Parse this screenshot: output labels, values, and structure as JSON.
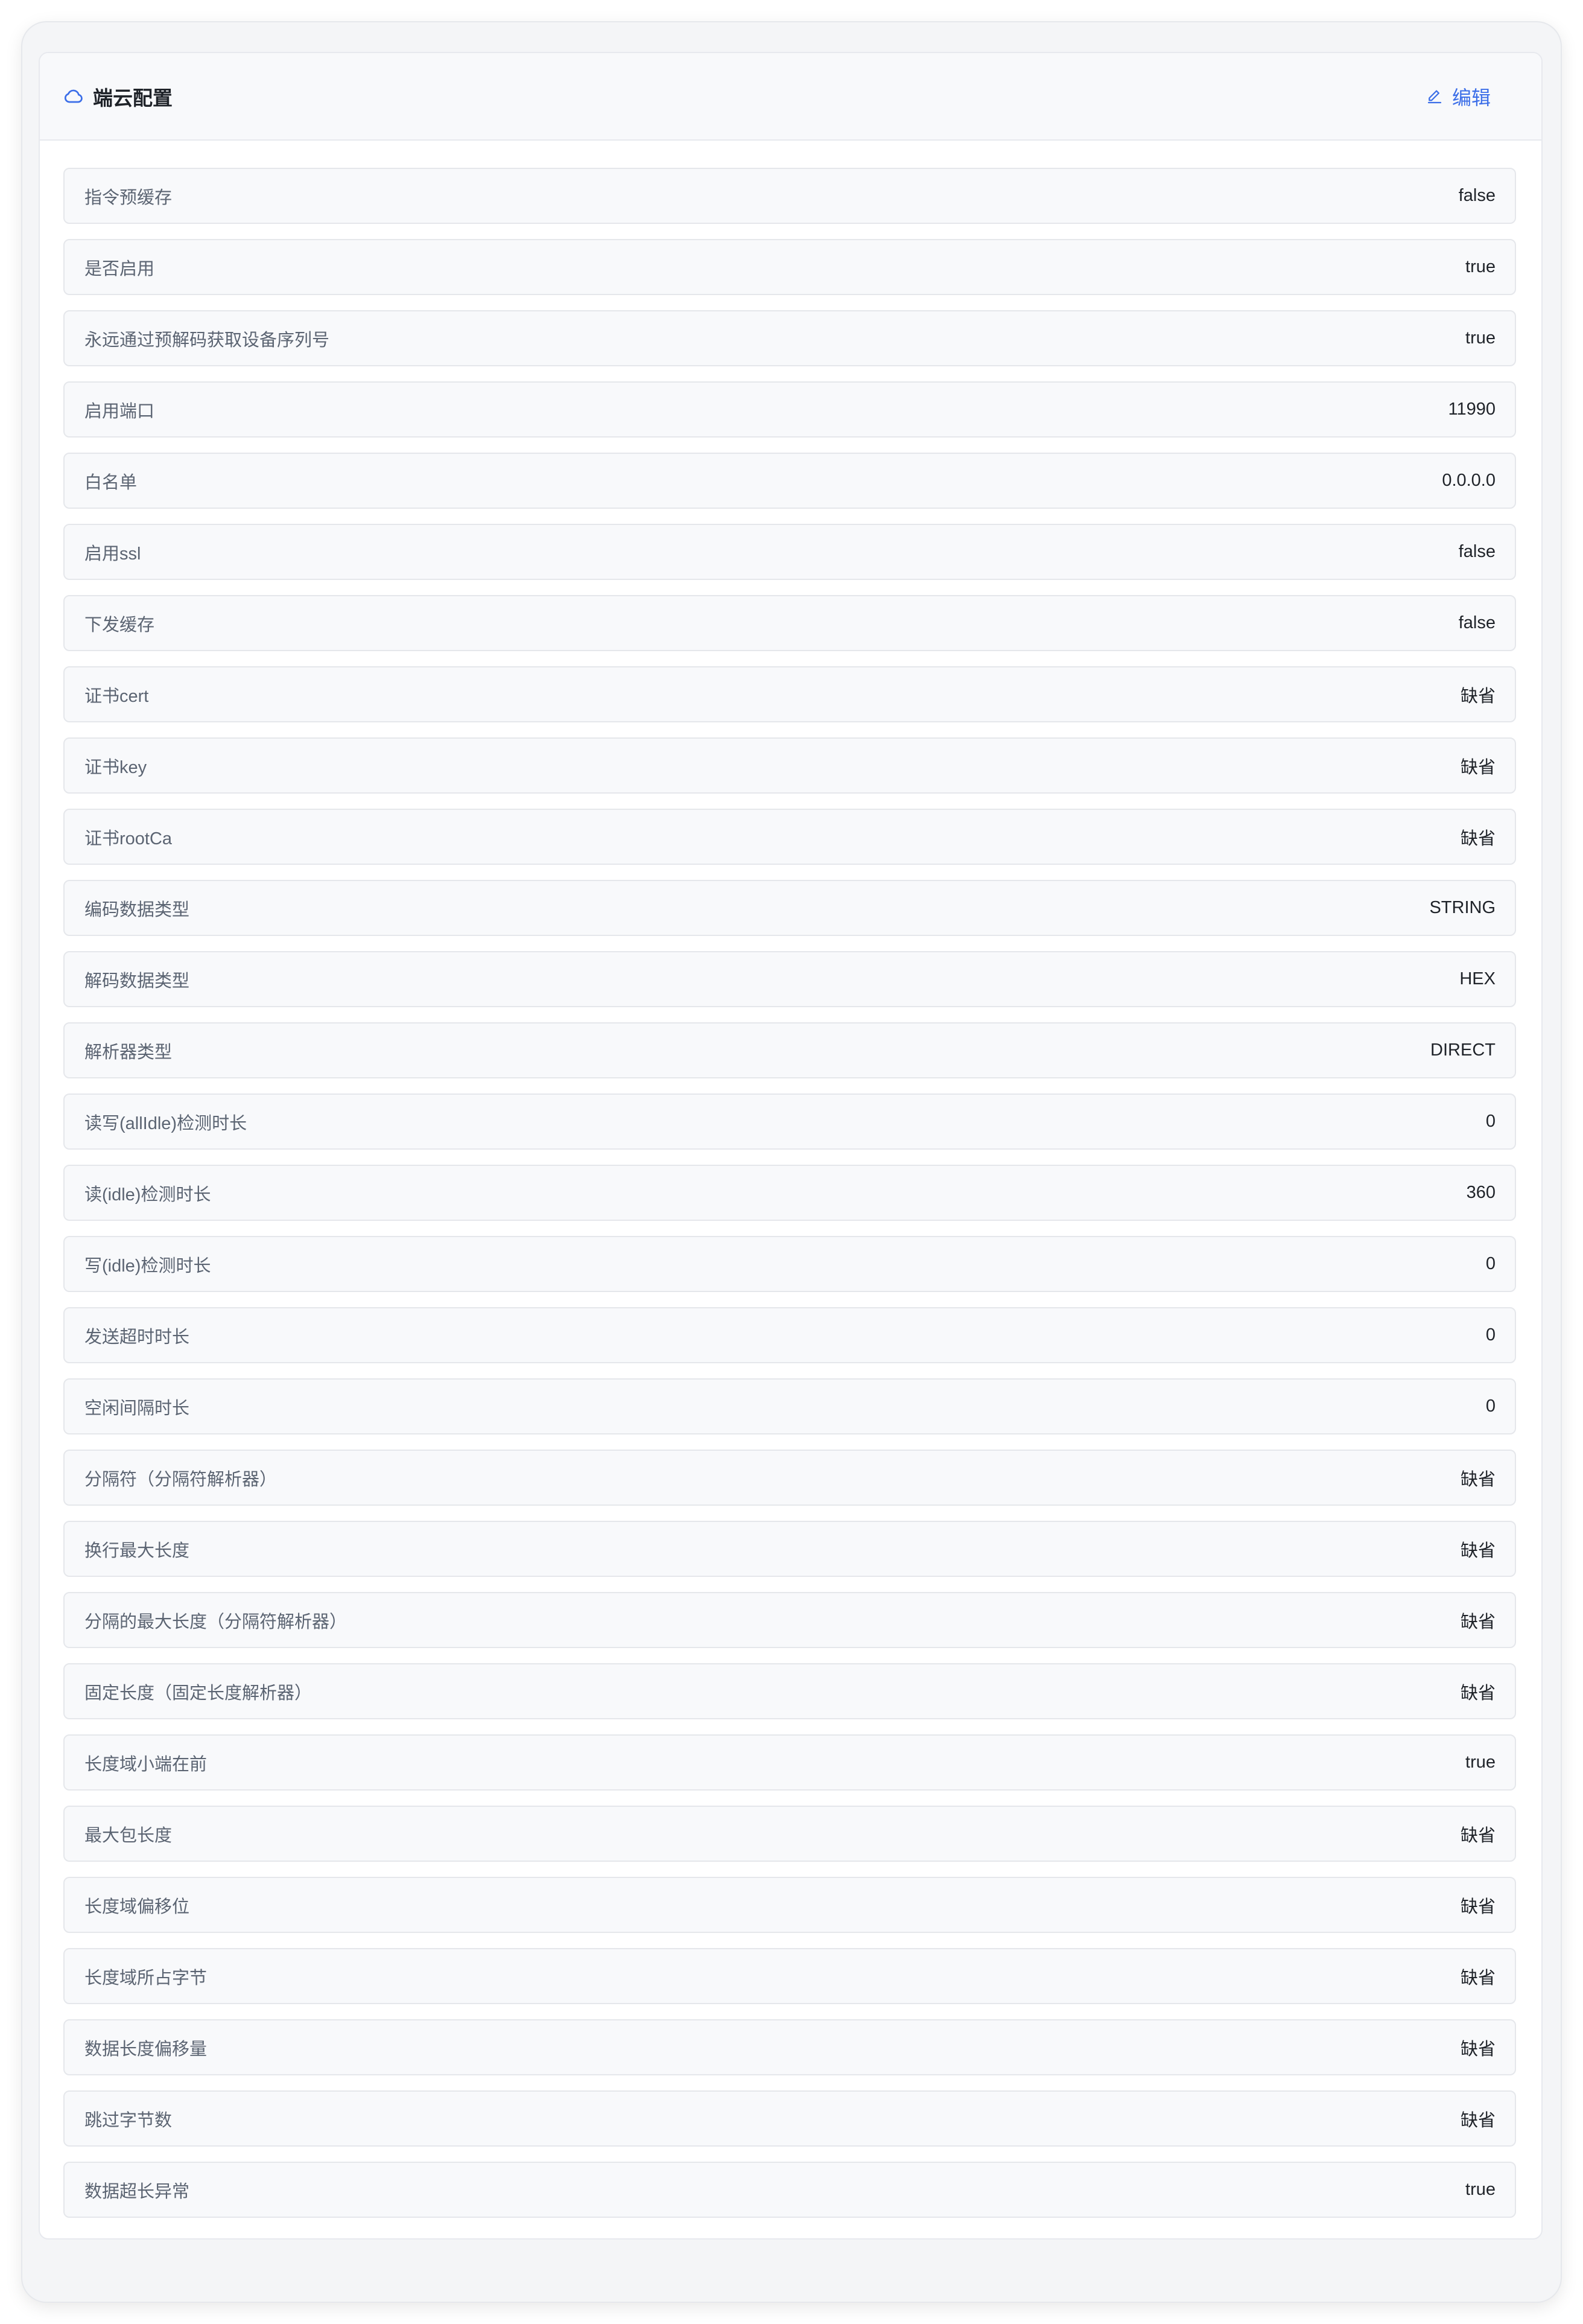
{
  "header": {
    "title": "端云配置",
    "icon": "cloud-icon",
    "edit_label": "编辑",
    "accent_color": "#3b6ee8"
  },
  "rows": [
    {
      "label": "指令预缓存",
      "value": "false"
    },
    {
      "label": "是否启用",
      "value": "true"
    },
    {
      "label": "永远通过预解码获取设备序列号",
      "value": "true"
    },
    {
      "label": "启用端口",
      "value": "11990"
    },
    {
      "label": "白名单",
      "value": "0.0.0.0"
    },
    {
      "label": "启用ssl",
      "value": "false"
    },
    {
      "label": "下发缓存",
      "value": "false"
    },
    {
      "label": "证书cert",
      "value": "缺省"
    },
    {
      "label": "证书key",
      "value": "缺省"
    },
    {
      "label": "证书rootCa",
      "value": "缺省"
    },
    {
      "label": "编码数据类型",
      "value": "STRING"
    },
    {
      "label": "解码数据类型",
      "value": "HEX"
    },
    {
      "label": "解析器类型",
      "value": "DIRECT"
    },
    {
      "label": "读写(allIdle)检测时长",
      "value": "0"
    },
    {
      "label": "读(idle)检测时长",
      "value": "360"
    },
    {
      "label": "写(idle)检测时长",
      "value": "0"
    },
    {
      "label": "发送超时时长",
      "value": "0"
    },
    {
      "label": "空闲间隔时长",
      "value": "0"
    },
    {
      "label": "分隔符（分隔符解析器）",
      "value": "缺省"
    },
    {
      "label": "换行最大长度",
      "value": "缺省"
    },
    {
      "label": "分隔的最大长度（分隔符解析器）",
      "value": "缺省"
    },
    {
      "label": "固定长度（固定长度解析器）",
      "value": "缺省"
    },
    {
      "label": "长度域小端在前",
      "value": "true"
    },
    {
      "label": "最大包长度",
      "value": "缺省"
    },
    {
      "label": "长度域偏移位",
      "value": "缺省"
    },
    {
      "label": "长度域所占字节",
      "value": "缺省"
    },
    {
      "label": "数据长度偏移量",
      "value": "缺省"
    },
    {
      "label": "跳过字节数",
      "value": "缺省"
    },
    {
      "label": "数据超长异常",
      "value": "true"
    }
  ]
}
